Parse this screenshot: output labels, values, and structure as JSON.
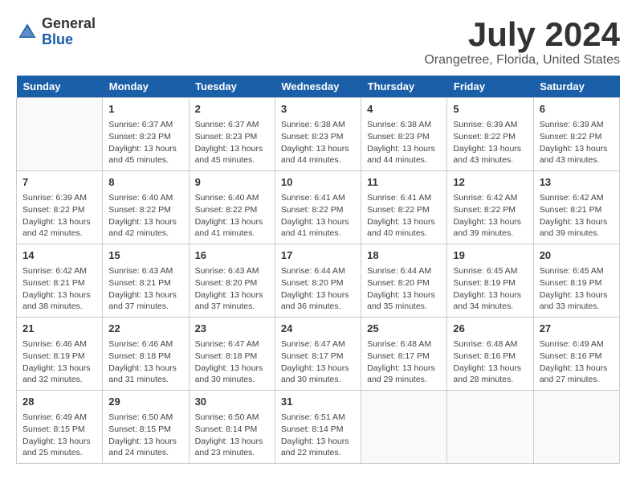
{
  "header": {
    "logo_general": "General",
    "logo_blue": "Blue",
    "month_year": "July 2024",
    "location": "Orangetree, Florida, United States"
  },
  "days_of_week": [
    "Sunday",
    "Monday",
    "Tuesday",
    "Wednesday",
    "Thursday",
    "Friday",
    "Saturday"
  ],
  "weeks": [
    [
      {
        "day": "",
        "empty": true
      },
      {
        "day": "1",
        "sunrise": "6:37 AM",
        "sunset": "8:23 PM",
        "daylight": "13 hours and 45 minutes."
      },
      {
        "day": "2",
        "sunrise": "6:37 AM",
        "sunset": "8:23 PM",
        "daylight": "13 hours and 45 minutes."
      },
      {
        "day": "3",
        "sunrise": "6:38 AM",
        "sunset": "8:23 PM",
        "daylight": "13 hours and 44 minutes."
      },
      {
        "day": "4",
        "sunrise": "6:38 AM",
        "sunset": "8:23 PM",
        "daylight": "13 hours and 44 minutes."
      },
      {
        "day": "5",
        "sunrise": "6:39 AM",
        "sunset": "8:22 PM",
        "daylight": "13 hours and 43 minutes."
      },
      {
        "day": "6",
        "sunrise": "6:39 AM",
        "sunset": "8:22 PM",
        "daylight": "13 hours and 43 minutes."
      }
    ],
    [
      {
        "day": "7",
        "sunrise": "6:39 AM",
        "sunset": "8:22 PM",
        "daylight": "13 hours and 42 minutes."
      },
      {
        "day": "8",
        "sunrise": "6:40 AM",
        "sunset": "8:22 PM",
        "daylight": "13 hours and 42 minutes."
      },
      {
        "day": "9",
        "sunrise": "6:40 AM",
        "sunset": "8:22 PM",
        "daylight": "13 hours and 41 minutes."
      },
      {
        "day": "10",
        "sunrise": "6:41 AM",
        "sunset": "8:22 PM",
        "daylight": "13 hours and 41 minutes."
      },
      {
        "day": "11",
        "sunrise": "6:41 AM",
        "sunset": "8:22 PM",
        "daylight": "13 hours and 40 minutes."
      },
      {
        "day": "12",
        "sunrise": "6:42 AM",
        "sunset": "8:22 PM",
        "daylight": "13 hours and 39 minutes."
      },
      {
        "day": "13",
        "sunrise": "6:42 AM",
        "sunset": "8:21 PM",
        "daylight": "13 hours and 39 minutes."
      }
    ],
    [
      {
        "day": "14",
        "sunrise": "6:42 AM",
        "sunset": "8:21 PM",
        "daylight": "13 hours and 38 minutes."
      },
      {
        "day": "15",
        "sunrise": "6:43 AM",
        "sunset": "8:21 PM",
        "daylight": "13 hours and 37 minutes."
      },
      {
        "day": "16",
        "sunrise": "6:43 AM",
        "sunset": "8:20 PM",
        "daylight": "13 hours and 37 minutes."
      },
      {
        "day": "17",
        "sunrise": "6:44 AM",
        "sunset": "8:20 PM",
        "daylight": "13 hours and 36 minutes."
      },
      {
        "day": "18",
        "sunrise": "6:44 AM",
        "sunset": "8:20 PM",
        "daylight": "13 hours and 35 minutes."
      },
      {
        "day": "19",
        "sunrise": "6:45 AM",
        "sunset": "8:19 PM",
        "daylight": "13 hours and 34 minutes."
      },
      {
        "day": "20",
        "sunrise": "6:45 AM",
        "sunset": "8:19 PM",
        "daylight": "13 hours and 33 minutes."
      }
    ],
    [
      {
        "day": "21",
        "sunrise": "6:46 AM",
        "sunset": "8:19 PM",
        "daylight": "13 hours and 32 minutes."
      },
      {
        "day": "22",
        "sunrise": "6:46 AM",
        "sunset": "8:18 PM",
        "daylight": "13 hours and 31 minutes."
      },
      {
        "day": "23",
        "sunrise": "6:47 AM",
        "sunset": "8:18 PM",
        "daylight": "13 hours and 30 minutes."
      },
      {
        "day": "24",
        "sunrise": "6:47 AM",
        "sunset": "8:17 PM",
        "daylight": "13 hours and 30 minutes."
      },
      {
        "day": "25",
        "sunrise": "6:48 AM",
        "sunset": "8:17 PM",
        "daylight": "13 hours and 29 minutes."
      },
      {
        "day": "26",
        "sunrise": "6:48 AM",
        "sunset": "8:16 PM",
        "daylight": "13 hours and 28 minutes."
      },
      {
        "day": "27",
        "sunrise": "6:49 AM",
        "sunset": "8:16 PM",
        "daylight": "13 hours and 27 minutes."
      }
    ],
    [
      {
        "day": "28",
        "sunrise": "6:49 AM",
        "sunset": "8:15 PM",
        "daylight": "13 hours and 25 minutes."
      },
      {
        "day": "29",
        "sunrise": "6:50 AM",
        "sunset": "8:15 PM",
        "daylight": "13 hours and 24 minutes."
      },
      {
        "day": "30",
        "sunrise": "6:50 AM",
        "sunset": "8:14 PM",
        "daylight": "13 hours and 23 minutes."
      },
      {
        "day": "31",
        "sunrise": "6:51 AM",
        "sunset": "8:14 PM",
        "daylight": "13 hours and 22 minutes."
      },
      {
        "day": "",
        "empty": true
      },
      {
        "day": "",
        "empty": true
      },
      {
        "day": "",
        "empty": true
      }
    ]
  ],
  "labels": {
    "sunrise_prefix": "Sunrise: ",
    "sunset_prefix": "Sunset: ",
    "daylight_prefix": "Daylight: "
  }
}
